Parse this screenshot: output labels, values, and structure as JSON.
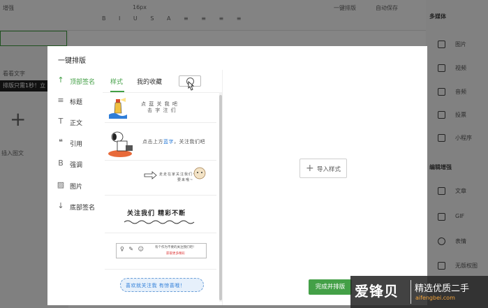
{
  "background": {
    "top_left_label": "增强",
    "left_labels": [
      "看看文字",
      "排版只需1秒！立"
    ],
    "left_bottom_label": "插入图文",
    "toolbar_labels": [
      "16px",
      "一键排版",
      "自动保存"
    ],
    "right_header": "多媒体",
    "right_items": [
      "图片",
      "视频",
      "音频",
      "投票",
      "小程序"
    ],
    "right_header2": "编辑增强",
    "right_items2": [
      "文章",
      "GIF",
      "表情",
      "无版权图"
    ]
  },
  "modal": {
    "title": "一键排版",
    "categories": [
      {
        "icon": "arrow-up-icon",
        "glyph": "↑",
        "label": "顶部签名",
        "active": true
      },
      {
        "icon": "list-icon",
        "glyph": "≡",
        "label": "标题",
        "active": false
      },
      {
        "icon": "text-icon",
        "glyph": "T",
        "label": "正文",
        "active": false
      },
      {
        "icon": "quote-icon",
        "glyph": "❝",
        "label": "引用",
        "active": false
      },
      {
        "icon": "bold-icon",
        "glyph": "B",
        "label": "强调",
        "active": false
      },
      {
        "icon": "image-icon",
        "glyph": "▨",
        "label": "图片",
        "active": false
      },
      {
        "icon": "arrow-down-icon",
        "glyph": "↓",
        "label": "底部签名",
        "active": false
      }
    ],
    "tabs": [
      {
        "label": "样式",
        "active": true
      },
      {
        "label": "我的收藏",
        "active": false
      }
    ],
    "templates": {
      "t1_line1": "点 蓝 关 我 吧",
      "t1_line2": "击 字 注 们",
      "t2_text_pre": "点击上方",
      "t2_text_blue": "蓝字",
      "t2_text_post": "，关注我们吧",
      "t3_line1": "走走在家关注我们~",
      "t3_line2": "要来哦~",
      "t4_text": "关注我们 精彩不断",
      "t5_line1": "有个作为不要的关注我们吧！",
      "t5_line2": "获取更多精彩",
      "t6_text": "喜欢就关注我 有惊喜哦！"
    },
    "import_label": "导入样式",
    "finish_label": "完成并排版"
  },
  "watermark": {
    "main": "爱锋贝",
    "sub": "精选优质二手",
    "url": "aifengbei.com"
  },
  "colors": {
    "accent": "#44a047",
    "link": "#2f7ed8"
  }
}
